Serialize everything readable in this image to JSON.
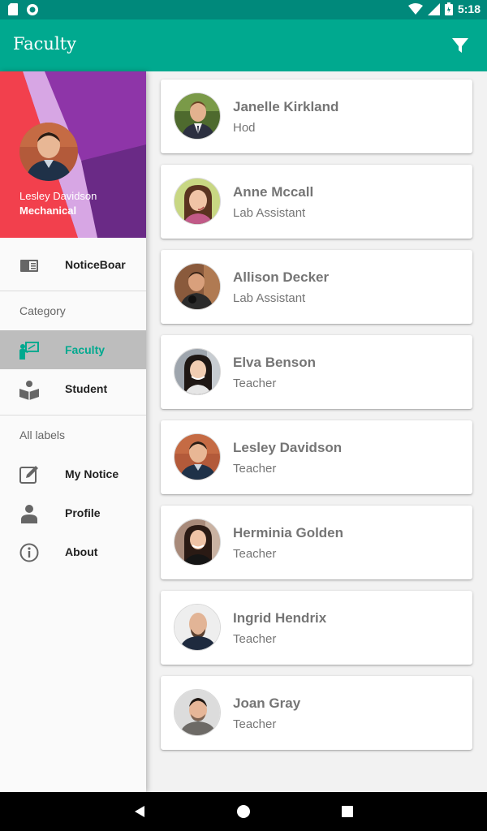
{
  "status_bar": {
    "time": "5:18"
  },
  "app_bar": {
    "title": "Faculty",
    "action_icon": "filter-icon"
  },
  "drawer": {
    "header": {
      "name": "Lesley Davidson",
      "department": "Mechanical"
    },
    "items": [
      {
        "label": "NoticeBoar",
        "icon": "notice-board-icon"
      }
    ],
    "category": {
      "title": "Category",
      "items": [
        {
          "label": "Faculty",
          "icon": "faculty-icon",
          "active": true
        },
        {
          "label": "Student",
          "icon": "student-icon"
        }
      ]
    },
    "labels": {
      "title": "All labels",
      "items": [
        {
          "label": "My Notice",
          "icon": "edit-icon"
        },
        {
          "label": "Profile",
          "icon": "person-icon"
        },
        {
          "label": "About",
          "icon": "info-icon"
        }
      ]
    }
  },
  "faculty_list": [
    {
      "name": "Janelle Kirkland",
      "role": "Hod"
    },
    {
      "name": "Anne Mccall",
      "role": "Lab Assistant"
    },
    {
      "name": "Allison Decker",
      "role": "Lab Assistant"
    },
    {
      "name": "Elva Benson",
      "role": "Teacher"
    },
    {
      "name": "Lesley Davidson",
      "role": "Teacher"
    },
    {
      "name": "Herminia Golden",
      "role": "Teacher"
    },
    {
      "name": "Ingrid Hendrix",
      "role": "Teacher"
    },
    {
      "name": "Joan Gray",
      "role": "Teacher"
    }
  ],
  "colors": {
    "primary": "#00a98f",
    "primary_dark": "#00897b",
    "accent_text": "#00a98f",
    "card_text": "#757575"
  }
}
